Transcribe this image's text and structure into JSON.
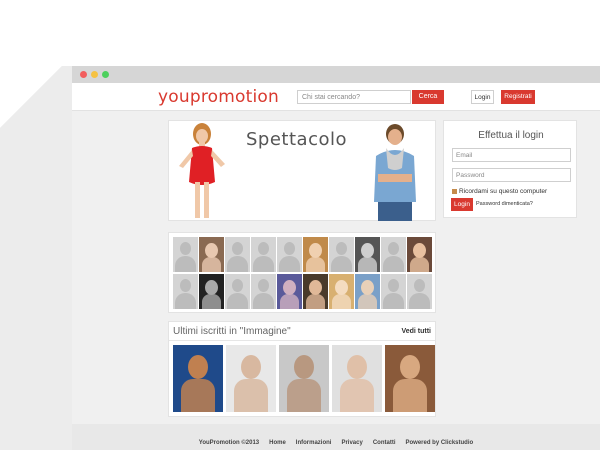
{
  "navbar": {
    "logo": "youpromotion",
    "search_placeholder": "Chi stai cercando?",
    "search_button": "Cerca",
    "login_button": "Login",
    "register_button": "Registrati"
  },
  "hero": {
    "title": "Spettacolo"
  },
  "login_box": {
    "title": "Effettua il login",
    "email_placeholder": "Email",
    "password_placeholder": "Password",
    "remember_label": "Ricordami su questo computer",
    "submit": "Login",
    "forgot": "Password dimenticata?"
  },
  "recent": {
    "title": "Ultimi iscritti in \"Immagine\"",
    "view_all": "Vedi tutti"
  },
  "footer": {
    "links": [
      "YouPromotion ©2013",
      "Home",
      "Informazioni",
      "Privacy",
      "Contatti",
      "Powered by Clickstudio"
    ]
  },
  "colors": {
    "accent": "#d9392f",
    "page_bg": "#f0f0f0"
  }
}
